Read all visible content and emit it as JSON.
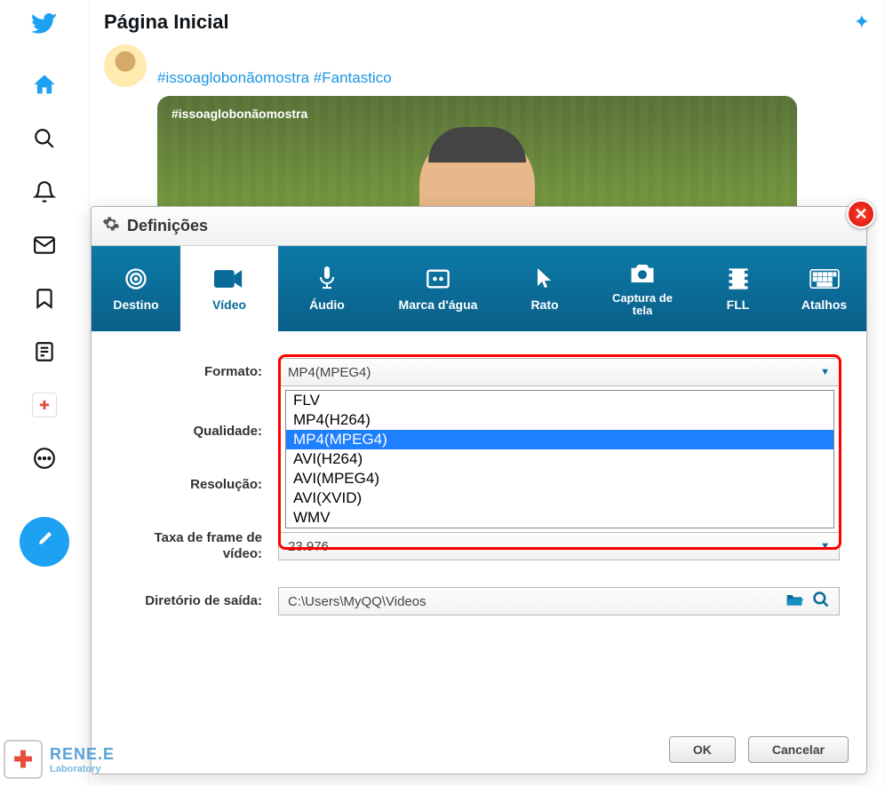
{
  "twitter": {
    "page_title": "Página Inicial",
    "hashtags": "#issoaglobonãomostra #Fantastico",
    "video_tag": "#issoaglobonãomostra"
  },
  "dialog": {
    "title": "Definições",
    "tabs": {
      "destino": "Destino",
      "video": "Vídeo",
      "audio": "Áudio",
      "marca": "Marca d'água",
      "rato": "Rato",
      "captura": "Captura de tela",
      "fll": "FLL",
      "atalhos": "Atalhos"
    },
    "form": {
      "formato_label": "Formato:",
      "formato_value": "MP4(MPEG4)",
      "qualidade_label": "Qualidade:",
      "resolucao_label": "Resolução:",
      "taxa_label": "Taxa de frame de vídeo:",
      "taxa_value": "23.976",
      "diretorio_label": "Diretório de saída:",
      "diretorio_value": "C:\\Users\\MyQQ\\Videos"
    },
    "dropdown_options": [
      "FLV",
      "MP4(H264)",
      "MP4(MPEG4)",
      "AVI(H264)",
      "AVI(MPEG4)",
      "AVI(XVID)",
      "WMV"
    ],
    "dropdown_selected_index": 2,
    "buttons": {
      "ok": "OK",
      "cancel": "Cancelar"
    }
  },
  "watermark": {
    "main": "RENE.E",
    "sub": "Laboratory"
  }
}
